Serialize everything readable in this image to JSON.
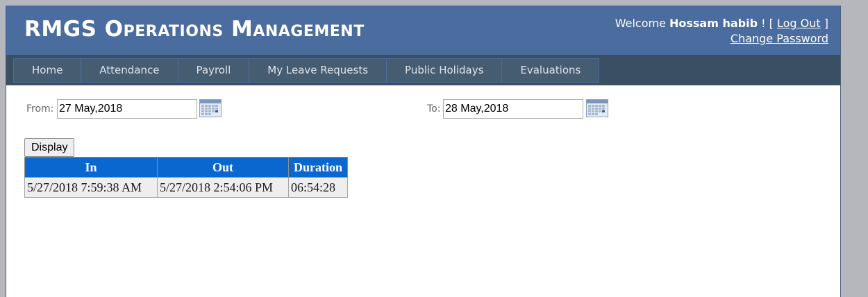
{
  "header": {
    "title": "RMGS Operations Management",
    "welcome_prefix": "Welcome",
    "user_name": "Hossam habib",
    "sep_open": "! [",
    "logout_label": "Log Out",
    "sep_close": "]",
    "change_password_label": "Change Password"
  },
  "menu": {
    "items": [
      {
        "label": "Home"
      },
      {
        "label": "Attendance"
      },
      {
        "label": "Payroll"
      },
      {
        "label": "My Leave Requests"
      },
      {
        "label": "Public Holidays"
      },
      {
        "label": "Evaluations"
      }
    ]
  },
  "filters": {
    "from_label": "From:",
    "from_value": "27 May,2018",
    "to_label": "To:",
    "to_value": "28 May,2018",
    "calendar_icon": "calendar-icon",
    "display_label": "Display"
  },
  "table": {
    "headers": [
      "In",
      "Out",
      "Duration"
    ],
    "rows": [
      [
        "5/27/2018 7:59:38 AM",
        "5/27/2018 2:54:06 PM",
        "06:54:28"
      ]
    ]
  },
  "colors": {
    "header_bg": "#4b6c9e",
    "nav_bg": "#3a4f63",
    "menu_item_bg": "#465c71",
    "table_header_bg": "#0b67d0",
    "table_cell_bg": "#eeeeee"
  }
}
